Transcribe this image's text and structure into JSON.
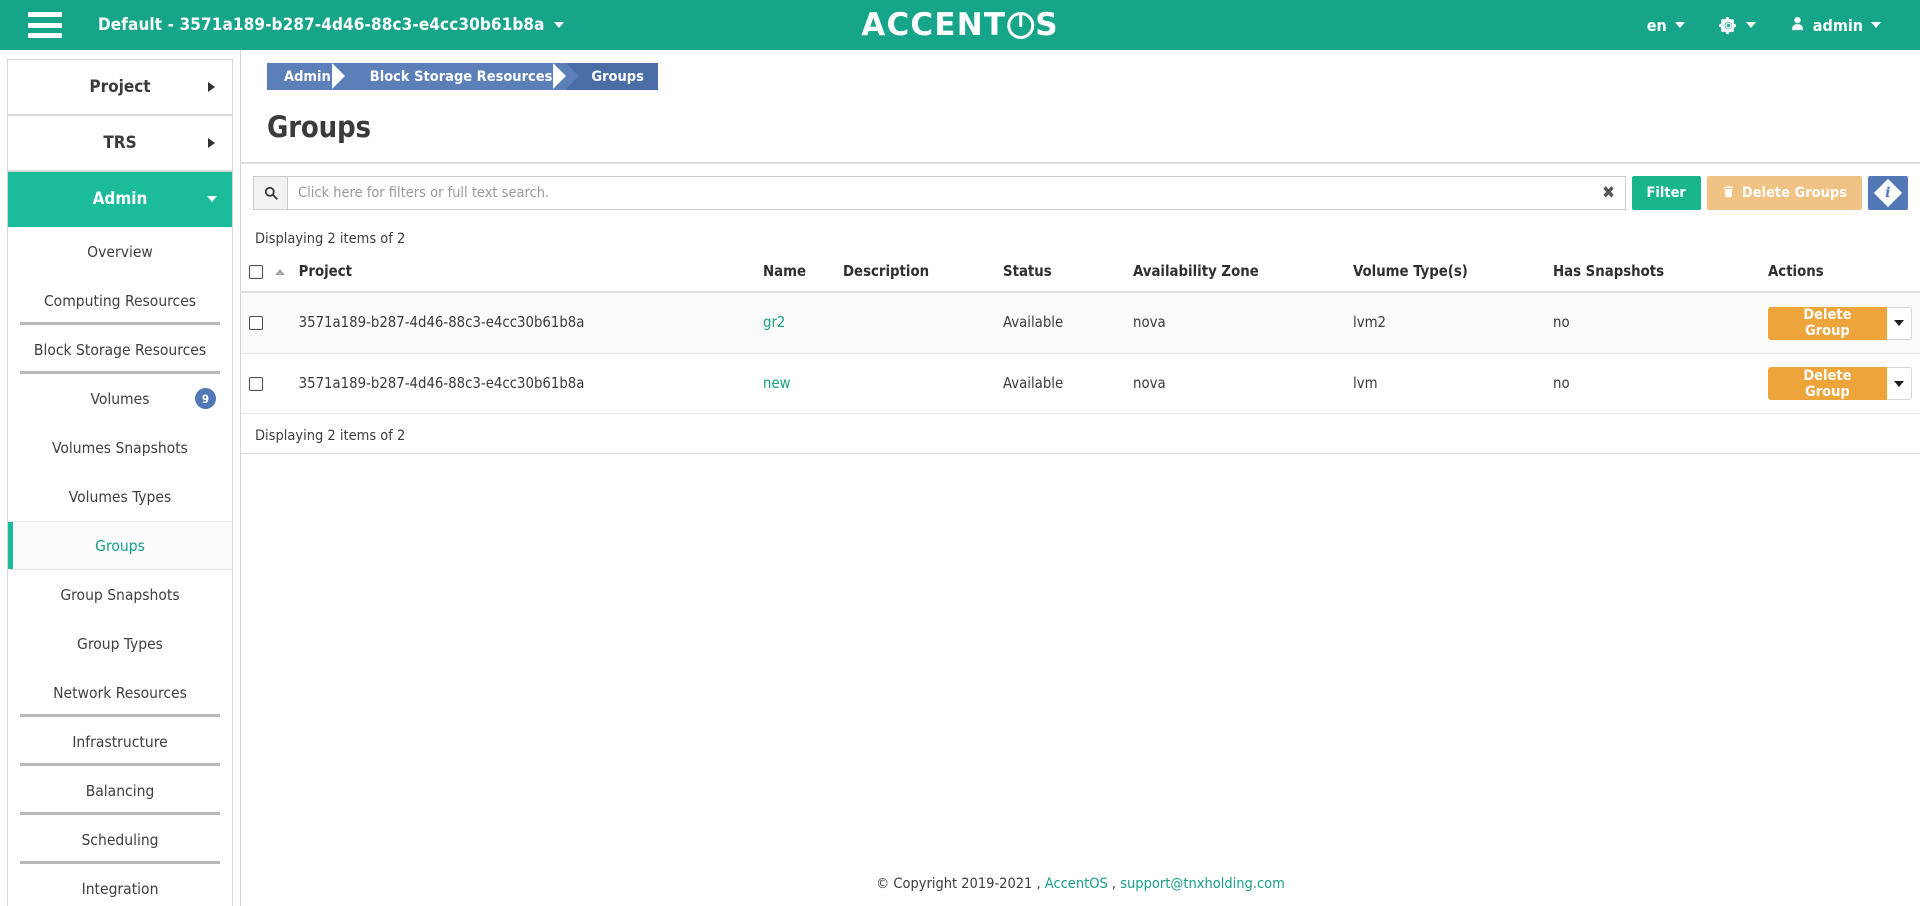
{
  "header": {
    "menu_icon": "hamburger-icon",
    "tenant": "Default - 3571a189-b287-4d46-88c3-e4cc30b61b8a",
    "brand_left": "ACCENT",
    "brand_right": "S",
    "language": "en",
    "settings_icon": "gear-icon",
    "user": "admin"
  },
  "sidebar": {
    "panels": [
      {
        "label": "Project",
        "active": false
      },
      {
        "label": "TRS",
        "active": false
      },
      {
        "label": "Admin",
        "active": true
      }
    ],
    "items": [
      {
        "label": "Overview",
        "active": false,
        "divider": false,
        "badge": ""
      },
      {
        "label": "Computing Resources",
        "active": false,
        "divider": true,
        "badge": ""
      },
      {
        "label": "Block Storage Resources",
        "active": false,
        "divider": true,
        "badge": ""
      },
      {
        "label": "Volumes",
        "active": false,
        "divider": false,
        "badge": "9"
      },
      {
        "label": "Volumes Snapshots",
        "active": false,
        "divider": false,
        "badge": ""
      },
      {
        "label": "Volumes Types",
        "active": false,
        "divider": false,
        "badge": ""
      },
      {
        "label": "Groups",
        "active": true,
        "divider": false,
        "badge": ""
      },
      {
        "label": "Group Snapshots",
        "active": false,
        "divider": false,
        "badge": ""
      },
      {
        "label": "Group Types",
        "active": false,
        "divider": false,
        "badge": ""
      },
      {
        "label": "Network Resources",
        "active": false,
        "divider": true,
        "badge": ""
      },
      {
        "label": "Infrastructure",
        "active": false,
        "divider": true,
        "badge": ""
      },
      {
        "label": "Balancing",
        "active": false,
        "divider": true,
        "badge": ""
      },
      {
        "label": "Scheduling",
        "active": false,
        "divider": true,
        "badge": ""
      },
      {
        "label": "Integration",
        "active": false,
        "divider": false,
        "badge": ""
      }
    ]
  },
  "breadcrumb": [
    {
      "label": "Admin",
      "current": false
    },
    {
      "label": "Block Storage Resources",
      "current": false
    },
    {
      "label": "Groups",
      "current": true
    }
  ],
  "page": {
    "title": "Groups"
  },
  "toolbar": {
    "search_icon": "search-icon",
    "search_value": "",
    "search_placeholder": "Click here for filters or full text search.",
    "clear_icon": "✖",
    "filter_label": "Filter",
    "delete_groups_label": "Delete Groups",
    "delete_groups_icon": "trash-icon",
    "info_label": "i",
    "info_icon": "info-diamond-icon"
  },
  "table": {
    "count_top": "Displaying 2 items of 2",
    "count_bottom": "Displaying 2 items of 2",
    "columns": [
      "Project",
      "Name",
      "Description",
      "Status",
      "Availability Zone",
      "Volume Type(s)",
      "Has Snapshots",
      "Actions"
    ],
    "rows": [
      {
        "project": "3571a189-b287-4d46-88c3-e4cc30b61b8a",
        "name": "gr2",
        "description": "",
        "status": "Available",
        "availability_zone": "nova",
        "volume_types": "lvm2",
        "has_snapshots": "no",
        "action_label": "Delete Group"
      },
      {
        "project": "3571a189-b287-4d46-88c3-e4cc30b61b8a",
        "name": "new",
        "description": "",
        "status": "Available",
        "availability_zone": "nova",
        "volume_types": "lvm",
        "has_snapshots": "no",
        "action_label": "Delete Group"
      }
    ]
  },
  "footer": {
    "copyright": "© Copyright 2019-2021 ,",
    "product_link": "AccentOS",
    "separator": ",",
    "email_link": "support@tnxholding.com"
  },
  "colors": {
    "header_teal": "#17a589",
    "active_teal": "#1abc9c",
    "link_teal": "#18a085",
    "breadcrumb_blue": "#5b7fb9",
    "breadcrumb_current_blue": "#4a6da6",
    "badge_blue": "#5279b5",
    "delete_orange": "#eda43a",
    "delete_groups_tan": "#f0c284",
    "filter_green": "#19b68c"
  }
}
